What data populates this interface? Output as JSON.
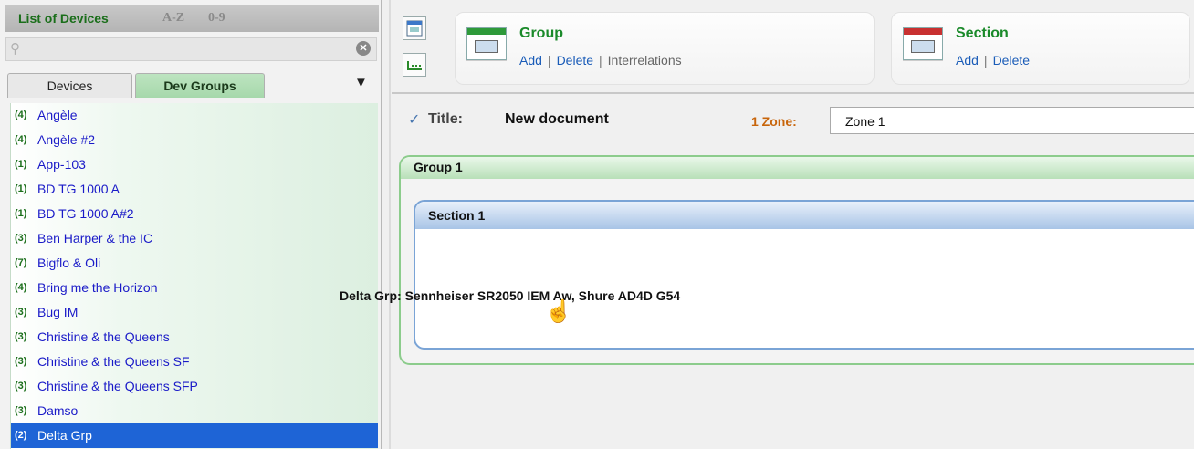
{
  "panel": {
    "title": "List of Devices",
    "sort_az": "A-Z",
    "sort_09": "0-9",
    "search": {
      "value": "",
      "placeholder": ""
    },
    "tabs": {
      "devices": "Devices",
      "groups": "Dev Groups",
      "active": "Dev Groups"
    },
    "items": [
      {
        "count": "(4)",
        "name": "Angèle"
      },
      {
        "count": "(4)",
        "name": "Angèle #2"
      },
      {
        "count": "(1)",
        "name": "App-103"
      },
      {
        "count": "(1)",
        "name": "BD TG 1000 A"
      },
      {
        "count": "(1)",
        "name": "BD TG 1000 A#2"
      },
      {
        "count": "(3)",
        "name": "Ben Harper & the IC"
      },
      {
        "count": "(7)",
        "name": "Bigflo & Oli"
      },
      {
        "count": "(4)",
        "name": "Bring me the Horizon"
      },
      {
        "count": "(3)",
        "name": "Bug IM"
      },
      {
        "count": "(3)",
        "name": "Christine & the Queens"
      },
      {
        "count": "(3)",
        "name": "Christine & the Queens SF"
      },
      {
        "count": "(3)",
        "name": "Christine & the Queens SFP"
      },
      {
        "count": "(3)",
        "name": "Damso"
      },
      {
        "count": "(2)",
        "name": "Delta Grp",
        "selected": true
      }
    ]
  },
  "toolbar": {
    "group": {
      "title": "Group",
      "add": "Add",
      "delete": "Delete",
      "interrelations": "Interrelations"
    },
    "section": {
      "title": "Section",
      "add": "Add",
      "delete": "Delete"
    },
    "separator": "|"
  },
  "document": {
    "title_label": "Title:",
    "title_value": "New document",
    "zone_label": "1 Zone:",
    "zone_value": "Zone 1",
    "group_title": "Group 1",
    "section_title": "Section 1",
    "assignment": "Delta Grp: Sennheiser SR2050 IEM Aw, Shure AD4D G54"
  },
  "colors": {
    "accent_green": "#1a8a2a",
    "link_blue": "#1a5cb8",
    "selection_blue": "#1e64d6",
    "zone_orange": "#c8650b"
  }
}
